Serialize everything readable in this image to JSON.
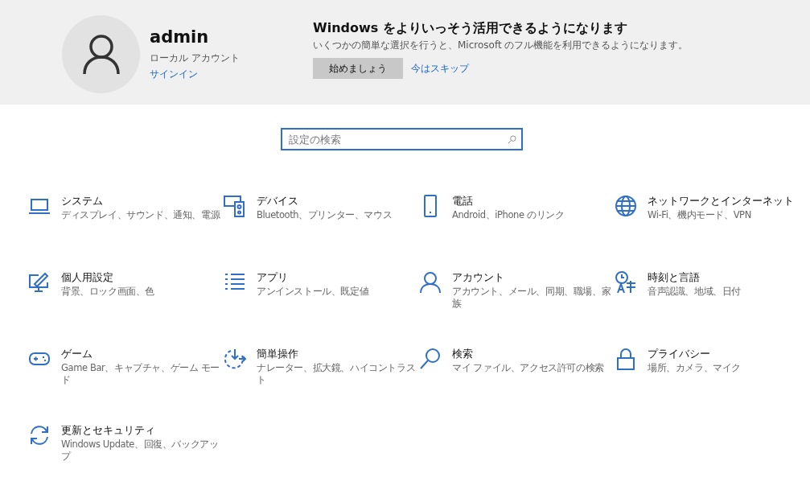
{
  "account": {
    "name": "admin",
    "type": "ローカル アカウント",
    "link": "サインイン"
  },
  "promo": {
    "title": "Windows をよりいっそう活用できるようになります",
    "text": "いくつかの簡単な選択を行うと、Microsoft のフル機能を利用できるようになります。",
    "primary_button": "始めましょう",
    "secondary_link": "今はスキップ"
  },
  "search": {
    "placeholder": "設定の検索"
  },
  "categories": [
    {
      "title": "システム",
      "subtitle": "ディスプレイ、サウンド、通知、電源"
    },
    {
      "title": "デバイス",
      "subtitle": "Bluetooth、プリンター、マウス"
    },
    {
      "title": "電話",
      "subtitle": "Android、iPhone のリンク"
    },
    {
      "title": "ネットワークとインターネット",
      "subtitle": "Wi-Fi、機内モード、VPN"
    },
    {
      "title": "個人用設定",
      "subtitle": "背景、ロック画面、色"
    },
    {
      "title": "アプリ",
      "subtitle": "アンインストール、既定値"
    },
    {
      "title": "アカウント",
      "subtitle": "アカウント、メール、同期、職場、家族"
    },
    {
      "title": "時刻と言語",
      "subtitle": "音声認識、地域、日付"
    },
    {
      "title": "ゲーム",
      "subtitle": "Game Bar、キャプチャ、ゲーム モード"
    },
    {
      "title": "簡単操作",
      "subtitle": "ナレーター、拡大鏡、ハイコントラスト"
    },
    {
      "title": "検索",
      "subtitle": "マイ ファイル、アクセス許可の検索"
    },
    {
      "title": "プライバシー",
      "subtitle": "場所、カメラ、マイク"
    },
    {
      "title": "更新とセキュリティ",
      "subtitle": "Windows Update、回復、バックアップ"
    }
  ]
}
